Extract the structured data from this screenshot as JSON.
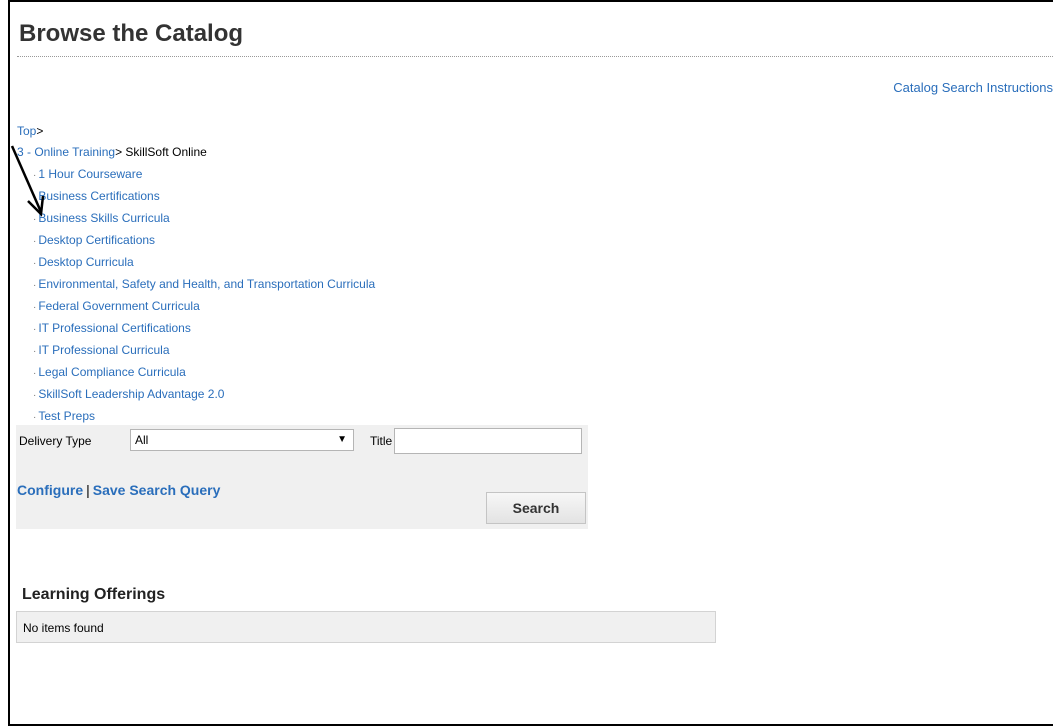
{
  "page": {
    "title": "Browse the Catalog"
  },
  "links": {
    "catalog_instructions": "Catalog Search Instructions"
  },
  "breadcrumb": {
    "top": "Top",
    "separator": ">",
    "parent": "3 - Online Training",
    "current": "SkillSoft Online"
  },
  "categories": [
    "1 Hour Courseware",
    "Business Certifications",
    "Business Skills Curricula",
    "Desktop Certifications",
    "Desktop Curricula",
    "Environmental, Safety and Health, and Transportation Curricula",
    "Federal Government Curricula",
    "IT Professional Certifications",
    "IT Professional Curricula",
    "Legal Compliance Curricula",
    "SkillSoft Leadership Advantage 2.0",
    "Test Preps"
  ],
  "search": {
    "delivery_label": "Delivery Type",
    "delivery_value": "All",
    "title_label": "Title",
    "title_value": "",
    "configure_label": "Configure",
    "save_query_label": "Save Search Query",
    "search_button": "Search"
  },
  "offerings": {
    "heading": "Learning Offerings",
    "empty_text": "No items found"
  },
  "colors": {
    "link": "#2a6ebb",
    "panel_bg": "#f0f0f0"
  }
}
